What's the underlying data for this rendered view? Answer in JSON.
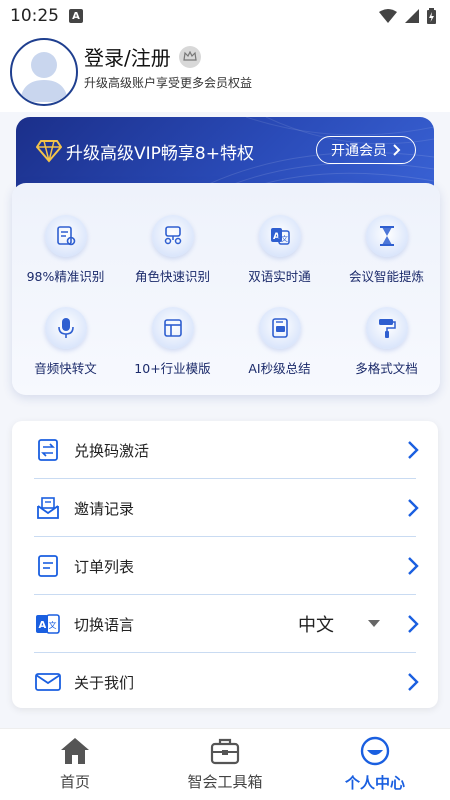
{
  "status_bar": {
    "time": "10:25"
  },
  "profile": {
    "title": "登录/注册",
    "subtitle": "升级高级账户享受更多会员权益"
  },
  "vip": {
    "title": "升级高级VIP畅享8+特权",
    "button_label": "开通会员"
  },
  "features": [
    {
      "label": "98%精准识别",
      "icon": "document-scan-icon"
    },
    {
      "label": "角色快速识别",
      "icon": "speaker-identify-icon"
    },
    {
      "label": "双语实时通",
      "icon": "translate-icon"
    },
    {
      "label": "会议智能提炼",
      "icon": "hourglass-icon"
    },
    {
      "label": "音频快转文",
      "icon": "microphone-icon"
    },
    {
      "label": "10+行业模版",
      "icon": "template-icon"
    },
    {
      "label": "AI秒级总结",
      "icon": "ai-summary-icon"
    },
    {
      "label": "多格式文档",
      "icon": "paint-roller-icon"
    }
  ],
  "menu": {
    "redeem": "兑换码激活",
    "invite": "邀请记录",
    "orders": "订单列表",
    "language": "切换语言",
    "language_value": "中文",
    "about": "关于我们"
  },
  "bottom_nav": {
    "home": "首页",
    "toolbox": "智会工具箱",
    "profile": "个人中心"
  },
  "colors": {
    "accent": "#1a5fe0",
    "vip_banner": "#1b2f8a"
  }
}
